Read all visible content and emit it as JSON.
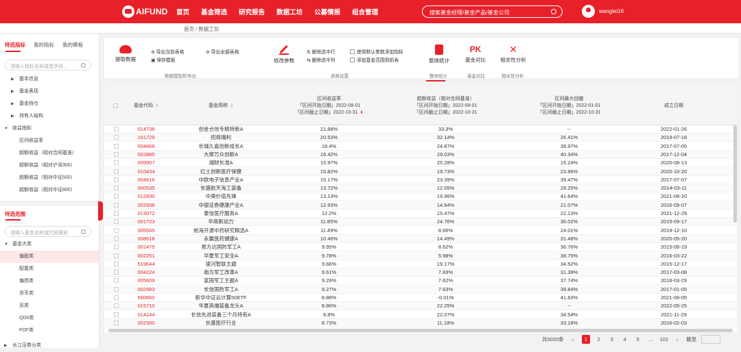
{
  "header": {
    "logo": "AIFUND",
    "nav": [
      "首页",
      "基金筛选",
      "研究报告",
      "数据工坊",
      "公募情报",
      "组合管理"
    ],
    "search_placeholder": "搜索基金经理/基金产品/基金公司",
    "user": "wanglei16"
  },
  "breadcrumb": "首页 / 数据工坊",
  "sidebar": {
    "tabs": [
      "待选指标",
      "我的指标",
      "我的模板"
    ],
    "indicator_search_placeholder": "请输入指标名和或首字母...",
    "indicator_groups": [
      "基本信息",
      "基金表现",
      "基金持仓",
      "持有人结构"
    ],
    "indicator_expanded": "收益指标",
    "indicator_children": [
      "区间收益率",
      "超额收益（相对合同基准）",
      "超额收益（相对沪深300）",
      "超额收益（相对中证500）",
      "超额收益（相对中证800）"
    ],
    "range_title": "待选范围",
    "fund_search_placeholder": "请输入基金名称或代码搜索",
    "fund_root": "基金大类",
    "fund_children": [
      "偏股类",
      "配置类",
      "偏债类",
      "货币类",
      "另类",
      "QDII类",
      "FOF类"
    ],
    "fund_more": "长江证券分类"
  },
  "toolbar": {
    "extract": "提取数据",
    "export_current": "导出当前表格",
    "save_template": "保存模板",
    "export_all": "导出全部表格",
    "modify_params": "修改参数",
    "delete_rows": "删除选中行",
    "delete_cols": "删除选中列",
    "use_default": "使用默认参数添加指标",
    "add_all_range": "添加基金范围到前表",
    "overall_stats": "整体统计",
    "fund_compare": "基金对比",
    "correlation": "相关性分析",
    "groups": [
      "数据提取和导出",
      "表格设置",
      "整体统计",
      "基金对比",
      "相关性分析"
    ]
  },
  "table": {
    "columns": {
      "code": "基金代码",
      "name": "基金简称",
      "return": [
        "区间收益率",
        "「区间开始日期」2022-08-01",
        "「区间截止日期」2022-10-31"
      ],
      "excess": [
        "超额收益（相对合同基准）",
        "「区间开始日期」2022-08-01",
        "「区间截止日期」2022-10-31"
      ],
      "drawdown": [
        "区间最大回撤",
        "「区间开始日期」2022-01-01",
        "「区间截止日期」2022-10-31"
      ],
      "inception": "成立日期"
    },
    "rows": [
      [
        "014736",
        "创金合信专精特新A",
        "21.88%",
        "33.3%",
        "--",
        "2022-01-26"
      ],
      [
        "161729",
        "招商瑞利",
        "20.53%",
        "32.14%",
        "26.41%",
        "2019-07-18"
      ],
      [
        "004666",
        "长城久嘉创新成长A",
        "18.4%",
        "24.87%",
        "39.97%",
        "2017-07-05"
      ],
      [
        "002885",
        "大摩万众创新A",
        "16.42%",
        "29.03%",
        "40.34%",
        "2017-12-04"
      ],
      [
        "009907",
        "湘财长淮A",
        "15.97%",
        "25.28%",
        "15.24%",
        "2020-08-13"
      ],
      [
        "010434",
        "红土创新医疗保健",
        "15.82%",
        "19.73%",
        "23.86%",
        "2020-10-20"
      ],
      [
        "004616",
        "中欧电子信息产业A",
        "15.17%",
        "23.39%",
        "39.47%",
        "2017-07-07"
      ],
      [
        "000535",
        "长盛航天海工装备",
        "13.72%",
        "12.05%",
        "29.25%",
        "2014-03-11"
      ],
      [
        "012930",
        "中庚价值先锋",
        "13.13%",
        "19.96%",
        "41.64%",
        "2021-08-20"
      ],
      [
        "002938",
        "中银证券健康产业A",
        "12.93%",
        "14.64%",
        "21.07%",
        "2016-09-07"
      ],
      [
        "013072",
        "泰信医疗服务A",
        "12.2%",
        "15.47%",
        "22.13%",
        "2021-12-29"
      ],
      [
        "001723",
        "华商新动力",
        "11.85%",
        "24.76%",
        "36.02%",
        "2015-09-17"
      ],
      [
        "005505",
        "前海开源中药研究精选A",
        "11.49%",
        "8.66%",
        "24.01%",
        "2019-12-10"
      ],
      [
        "008618",
        "永赢医药健康A",
        "10.46%",
        "14.49%",
        "31.48%",
        "2020-05-20"
      ],
      [
        "001475",
        "易方达国防军工A",
        "9.95%",
        "8.62%",
        "36.76%",
        "2015-06-19"
      ],
      [
        "002251",
        "华夏军工安全A",
        "9.78%",
        "5.98%",
        "38.75%",
        "2016-03-22"
      ],
      [
        "519644",
        "银河智联主题",
        "9.66%",
        "19.17%",
        "34.52%",
        "2015-12-17"
      ],
      [
        "004224",
        "南方军工改革A",
        "9.61%",
        "7.83%",
        "31.39%",
        "2017-03-08"
      ],
      [
        "005609",
        "富国军工主题A",
        "9.29%",
        "7.62%",
        "37.74%",
        "2018-03-29"
      ],
      [
        "002983",
        "长信国防军工A",
        "9.27%",
        "7.63%",
        "39.84%",
        "2017-01-05"
      ],
      [
        "560660",
        "新华中证云计算50ETF",
        "8.88%",
        "-0.01%",
        "41.83%",
        "2021-08-05"
      ],
      [
        "015710",
        "华夏高端装备龙头A",
        "8.86%",
        "22.25%",
        "--",
        "2022-05-25"
      ],
      [
        "014144",
        "长信先进装备三个月持有A",
        "8.8%",
        "22.07%",
        "34.54%",
        "2021-11-29"
      ],
      [
        "002300",
        "长盛医疗行业",
        "8.73%",
        "11.18%",
        "33.18%",
        "2016-02-03"
      ]
    ]
  },
  "pager": {
    "total": "共5020条",
    "prev": "‹",
    "pages": [
      "1",
      "2",
      "3",
      "4",
      "5",
      "...",
      "101"
    ],
    "next": "›",
    "jump": "跳至"
  }
}
